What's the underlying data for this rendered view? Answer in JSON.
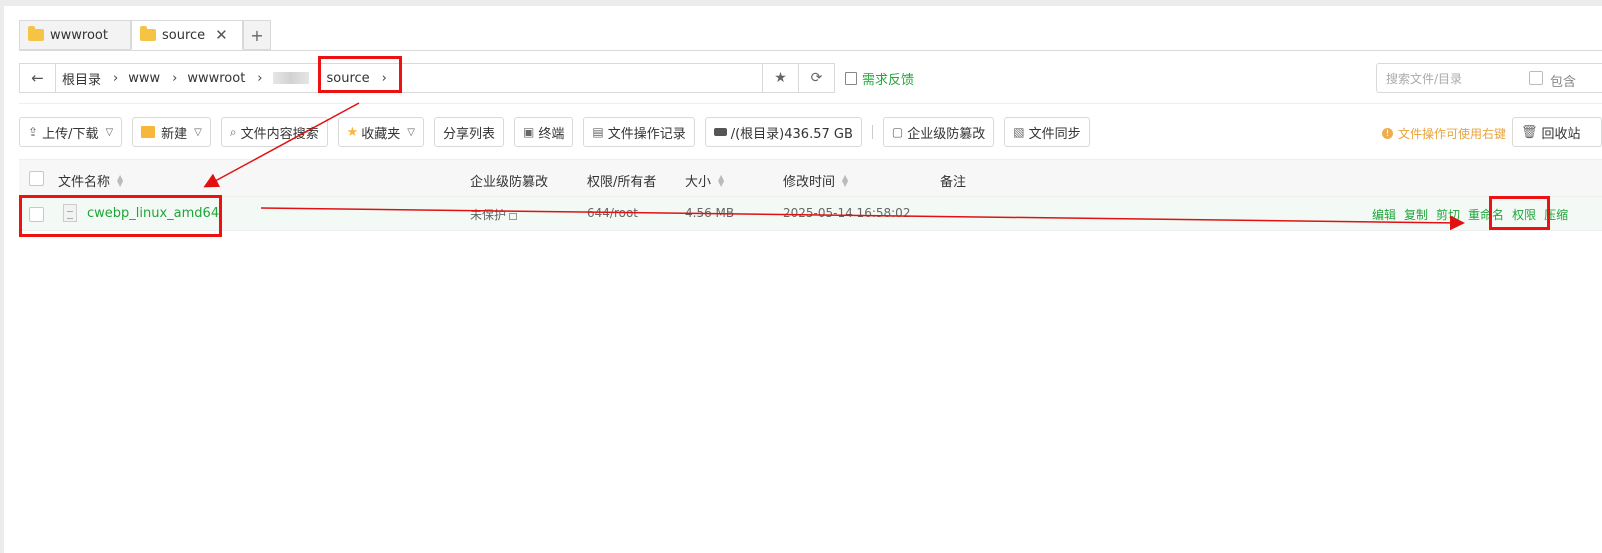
{
  "tabs": [
    {
      "label": "wwwroot",
      "active": false
    },
    {
      "label": "source",
      "active": true,
      "close": "✕"
    }
  ],
  "tab_add": "+",
  "path": {
    "back": "←",
    "crumbs": [
      "根目录",
      "www",
      "wwwroot",
      "source"
    ],
    "sep": "›"
  },
  "feedback": "需求反馈",
  "search": {
    "placeholder": "搜索文件/目录",
    "include_label": "包含"
  },
  "toolbar": {
    "upload": "上传/下载",
    "new": "新建",
    "content_search": "文件内容搜索",
    "favorites": "收藏夹",
    "share_list": "分享列表",
    "terminal": "终端",
    "op_log": "文件操作记录",
    "disk": "/(根目录)436.57 GB",
    "tamper": "企业级防篡改",
    "sync": "文件同步"
  },
  "tip": "文件操作可使用右键",
  "recycle": "回收站",
  "table": {
    "headers": {
      "name": "文件名称",
      "tamper": "企业级防篡改",
      "perm": "权限/所有者",
      "size": "大小",
      "mtime": "修改时间",
      "note": "备注"
    },
    "rows": [
      {
        "name": "cwebp_linux_amd64",
        "tamper": "未保护",
        "perm": "644/root",
        "size": "4.56 MB",
        "mtime": "2025-05-14 16:58:02",
        "note": "",
        "ops": [
          "编辑",
          "复制",
          "剪切",
          "重命名",
          "权限",
          "压缩"
        ]
      }
    ]
  },
  "colors": {
    "accent": "#20a53a",
    "annotation": "#e11111",
    "tip": "#e8a33d"
  }
}
